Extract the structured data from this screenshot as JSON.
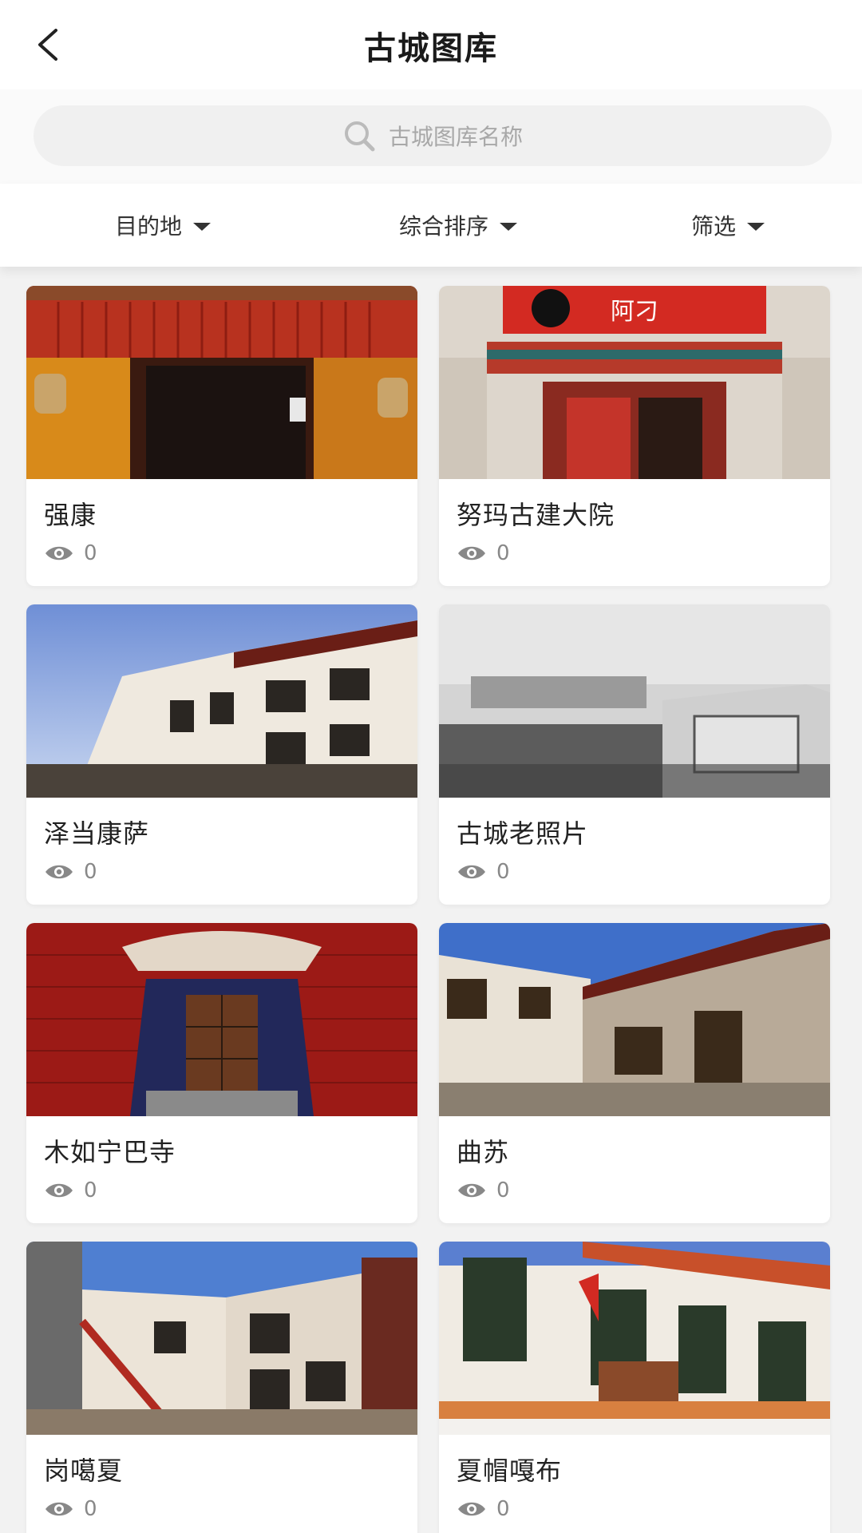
{
  "header": {
    "title": "古城图库",
    "back_icon": "back-chevron-icon"
  },
  "search": {
    "placeholder": "古城图库名称",
    "icon": "search-icon"
  },
  "filters": [
    {
      "label": "目的地"
    },
    {
      "label": "综合排序"
    },
    {
      "label": "筛选"
    }
  ],
  "items": [
    {
      "title": "强康",
      "views": "0"
    },
    {
      "title": "努玛古建大院",
      "views": "0",
      "sign_text": "阿刁"
    },
    {
      "title": "泽当康萨",
      "views": "0"
    },
    {
      "title": "古城老照片",
      "views": "0"
    },
    {
      "title": "木如宁巴寺",
      "views": "0"
    },
    {
      "title": "曲苏",
      "views": "0"
    },
    {
      "title": "岗噶夏",
      "views": "0"
    },
    {
      "title": "夏帽嘎布",
      "views": "0"
    }
  ],
  "colors": {
    "background": "#f2f2f2",
    "card": "#ffffff",
    "muted": "#888888"
  }
}
